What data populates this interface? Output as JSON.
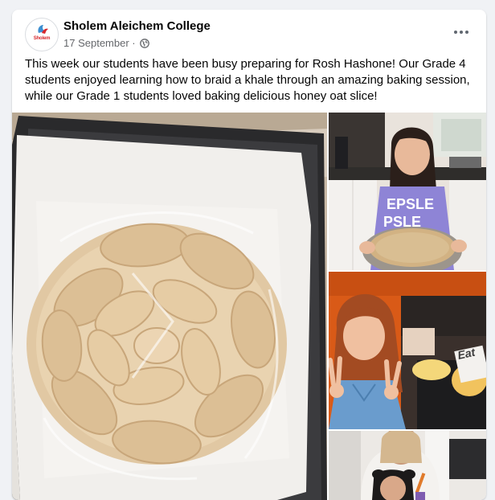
{
  "post": {
    "author": "Sholem Aleichem College",
    "avatar_text": "Sholem",
    "date": "17 September",
    "separator": "·",
    "audience_icon": "globe-icon",
    "more_icon": "more-options-icon",
    "text": "This week our students have been busy preparing for Rosh Hashone! Our Grade 4 students enjoyed learning how to braid a khale through an amazing baking session, while our Grade 1 students loved baking delicious honey oat slice!"
  },
  "photos": [
    {
      "name": "photo-braided-khale",
      "desc": "braided khale on baking tray"
    },
    {
      "name": "photo-student-bowl",
      "desc": "student holding bowl"
    },
    {
      "name": "photo-student-peace-sign",
      "desc": "student with peace signs"
    },
    {
      "name": "photo-students-baking",
      "desc": "students baking"
    }
  ],
  "photo_text": {
    "sweater_top": "EPSLE",
    "sweater_bottom": "PSLE",
    "bag_label": "Eat"
  },
  "colors": {
    "brand_red": "#d6262b",
    "text_primary": "#050505",
    "text_secondary": "#65676b"
  }
}
